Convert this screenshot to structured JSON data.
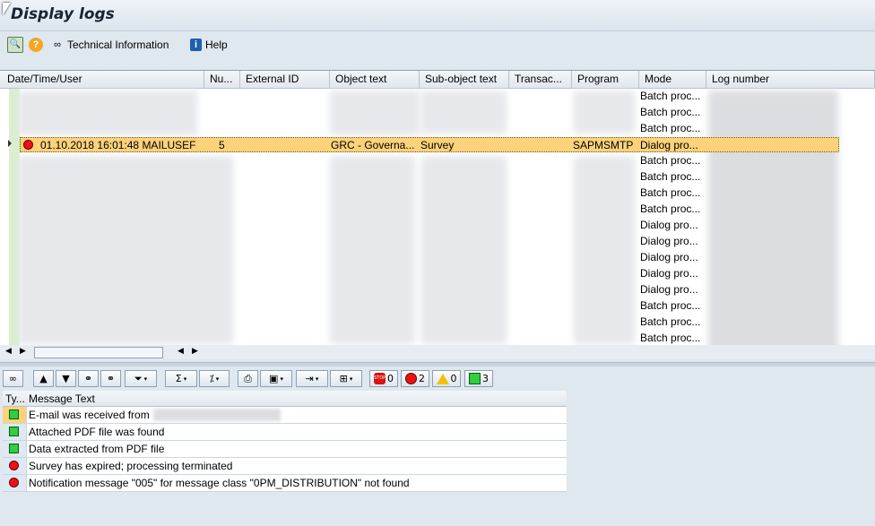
{
  "window": {
    "title": "Display logs"
  },
  "appbar": {
    "tech_info": "Technical Information",
    "help": "Help"
  },
  "grid": {
    "columns": [
      "Date/Time/User",
      "Nu...",
      "External ID",
      "Object text",
      "Sub-object text",
      "Transac...",
      "Program",
      "Mode",
      "Log number"
    ],
    "modes": [
      "Batch proc...",
      "Batch proc...",
      "Batch proc...",
      "Dialog pro...",
      "Batch proc...",
      "Batch proc...",
      "Batch proc...",
      "Batch proc...",
      "Dialog pro...",
      "Dialog pro...",
      "Dialog pro...",
      "Dialog pro...",
      "Dialog pro...",
      "Batch proc...",
      "Batch proc...",
      "Batch proc..."
    ],
    "selected_row": {
      "datetime_user": "01.10.2018  16:01:48  MAILUSEF",
      "number": "5",
      "object_text": "GRC - Governa...",
      "sub_object_text": "Survey",
      "program": "SAPMSMTP",
      "mode": "Dialog pro..."
    }
  },
  "msg_toolbar": {
    "stop_count": "0",
    "error_count": "2",
    "warning_count": "0",
    "success_count": "3"
  },
  "messages": {
    "header": {
      "type": "Ty...",
      "text": "Message Text"
    },
    "rows": [
      {
        "type": "success",
        "text": "E-mail was received from"
      },
      {
        "type": "success",
        "text": "Attached PDF file was found"
      },
      {
        "type": "success",
        "text": "Data extracted from PDF file"
      },
      {
        "type": "error",
        "text": "Survey has expired; processing terminated"
      },
      {
        "type": "error",
        "text": "Notification message \"005\" for message class \"0PM_DISTRIBUTION\" not found"
      }
    ]
  }
}
